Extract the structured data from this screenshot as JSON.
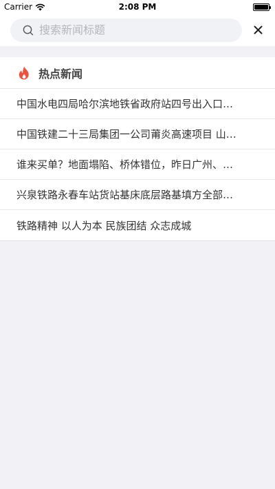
{
  "status_bar": {
    "carrier": "Carrier",
    "time": "2:08 PM",
    "battery_level": 1.0
  },
  "search": {
    "placeholder": "搜索新闻标题",
    "value": "",
    "icon": "search-icon",
    "close_icon": "close-icon"
  },
  "hot_news": {
    "icon": "flame-icon",
    "icon_color": "#f0513c",
    "title": "热点新闻",
    "items": [
      "中国水电四局哈尔滨地铁省政府站四号出入口…",
      "中国铁建二十三局集团一公司莆炎高速项目 山…",
      "谁来买单？地面塌陷、桥体错位，昨日广州、…",
      "兴泉铁路永春车站货站基床底层路基填方全部…",
      "铁路精神 以人为本 民族团结 众志成城"
    ]
  }
}
